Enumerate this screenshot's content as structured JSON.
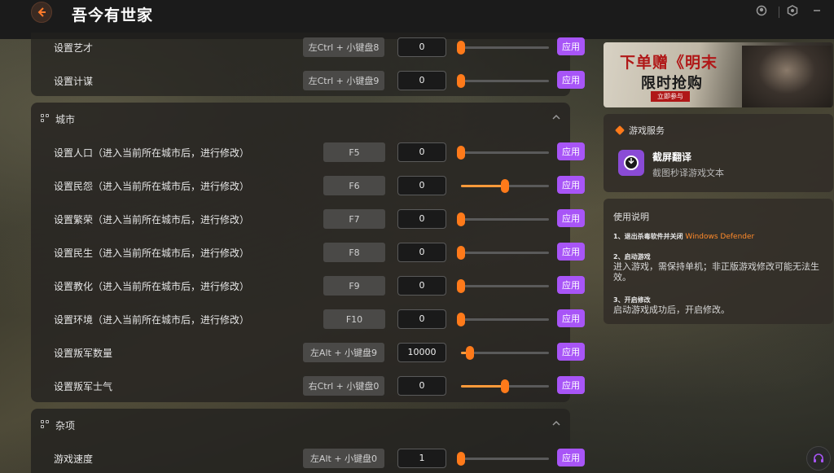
{
  "app": {
    "title": "吾今有世家",
    "back_icon": "back-arrow-icon"
  },
  "window": {
    "icons": [
      "user-icon",
      "settings-icon",
      "minimize-icon"
    ]
  },
  "colors": {
    "accent_orange": "#ff7a1a",
    "apply_purple": "#a855f7",
    "slider_fill": "#ff9a3a"
  },
  "top_rows": [
    {
      "label": "设置艺才",
      "hotkey": "左Ctrl + 小键盘8",
      "value": "0",
      "slider": 0,
      "apply": "应用"
    },
    {
      "label": "设置计谋",
      "hotkey": "左Ctrl + 小键盘9",
      "value": "0",
      "slider": 0,
      "apply": "应用"
    }
  ],
  "city": {
    "title": "城市",
    "rows": [
      {
        "label": "设置人口（进入当前所在城市后，进行修改）",
        "hotkey": "F5",
        "value": "0",
        "slider": 0,
        "apply": "应用"
      },
      {
        "label": "设置民怨（进入当前所在城市后，进行修改）",
        "hotkey": "F6",
        "value": "0",
        "slider": 0.5,
        "apply": "应用"
      },
      {
        "label": "设置繁荣（进入当前所在城市后，进行修改）",
        "hotkey": "F7",
        "value": "0",
        "slider": 0,
        "apply": "应用"
      },
      {
        "label": "设置民生（进入当前所在城市后，进行修改）",
        "hotkey": "F8",
        "value": "0",
        "slider": 0,
        "apply": "应用"
      },
      {
        "label": "设置教化（进入当前所在城市后，进行修改）",
        "hotkey": "F9",
        "value": "0",
        "slider": 0,
        "apply": "应用"
      },
      {
        "label": "设置环境（进入当前所在城市后，进行修改）",
        "hotkey": "F10",
        "value": "0",
        "slider": 0,
        "apply": "应用"
      },
      {
        "label": "设置叛军数量",
        "hotkey": "左Alt + 小键盘9",
        "value": "10000",
        "slider": 0.1,
        "apply": "应用"
      },
      {
        "label": "设置叛军士气",
        "hotkey": "右Ctrl + 小键盘0",
        "value": "0",
        "slider": 0.5,
        "apply": "应用"
      }
    ]
  },
  "misc": {
    "title": "杂项",
    "rows": [
      {
        "label": "游戏速度",
        "hotkey": "左Alt + 小键盘0",
        "value": "1",
        "slider": 0,
        "apply": "应用"
      }
    ]
  },
  "ad": {
    "line1": "下单赠《明末",
    "line2": "限时抢购",
    "button": "立即参与"
  },
  "service": {
    "header": "游戏服务",
    "name": "截屏翻译",
    "desc": "截图秒译游戏文本"
  },
  "usage": {
    "title": "使用说明",
    "step1": "1、退出杀毒软件并关闭",
    "step1_highlight": "Windows Defender",
    "step2": "2、启动游戏",
    "step2_text": "进入游戏，需保持单机；非正版游戏修改可能无法生效。",
    "step3": "3、开启修改",
    "step3_text": "启动游戏成功后，开启修改。"
  }
}
